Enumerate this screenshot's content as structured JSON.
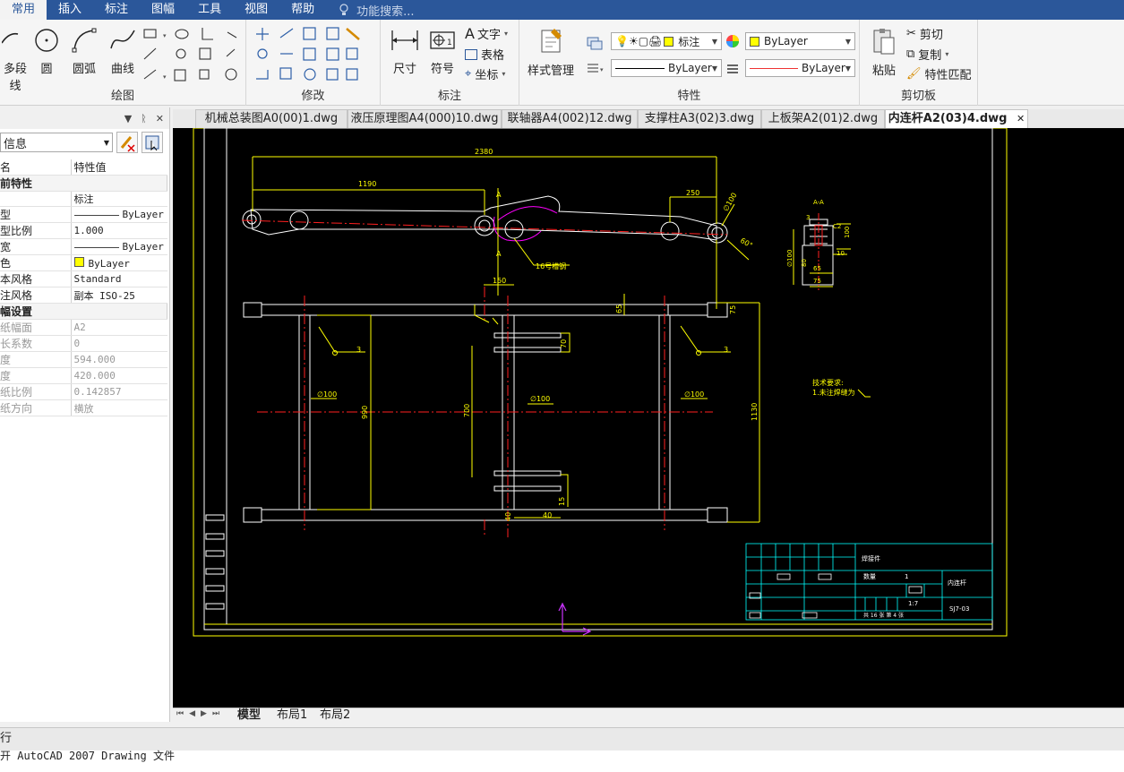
{
  "menu": {
    "items": [
      "常用",
      "插入",
      "标注",
      "图幅",
      "工具",
      "视图",
      "帮助"
    ],
    "search_placeholder": "功能搜索..."
  },
  "ribbon": {
    "draw": {
      "label": "绘图",
      "polyline": "多段线",
      "circle": "圆",
      "arc": "圆弧",
      "curve": "曲线"
    },
    "modify": {
      "label": "修改"
    },
    "dimension": {
      "label": "标注",
      "size": "尺寸",
      "symbol": "符号",
      "text": "文字",
      "table": "表格",
      "coord": "坐标"
    },
    "properties": {
      "label": "特性",
      "style_manager": "样式管理",
      "layer_name": "标注",
      "color_value": "ByLayer",
      "linetype_value": "ByLayer",
      "lineweight_value": "ByLayer"
    },
    "clipboard": {
      "label": "剪切板",
      "paste": "粘贴",
      "cut": "剪切",
      "copy": "复制",
      "match": "特性匹配"
    }
  },
  "props_panel": {
    "select_value": "信息",
    "rows": [
      {
        "k": "名",
        "v": "特性值",
        "kind": "header"
      },
      {
        "k": "前特性",
        "v": "",
        "kind": "sec"
      },
      {
        "k": "",
        "v": "标注",
        "kind": "row"
      },
      {
        "k": "型",
        "v": "ByLayer",
        "kind": "line"
      },
      {
        "k": "型比例",
        "v": "1.000",
        "kind": "row"
      },
      {
        "k": "宽",
        "v": "ByLayer",
        "kind": "line"
      },
      {
        "k": "色",
        "v": "ByLayer",
        "kind": "color"
      },
      {
        "k": "本风格",
        "v": "Standard",
        "kind": "row"
      },
      {
        "k": "注风格",
        "v": "副本 ISO-25",
        "kind": "row"
      },
      {
        "k": "幅设置",
        "v": "",
        "kind": "sec"
      },
      {
        "k": "纸幅面",
        "v": "A2",
        "kind": "dis"
      },
      {
        "k": "长系数",
        "v": "0",
        "kind": "dis"
      },
      {
        "k": "度",
        "v": "594.000",
        "kind": "dis"
      },
      {
        "k": "度",
        "v": "420.000",
        "kind": "dis"
      },
      {
        "k": "纸比例",
        "v": "0.142857",
        "kind": "dis"
      },
      {
        "k": "纸方向",
        "v": "横放",
        "kind": "dis"
      }
    ]
  },
  "doc_tabs": [
    "机械总装图A0(00)1.dwg",
    "液压原理图A4(000)10.dwg",
    "联轴器A4(002)12.dwg",
    "支撑柱A3(02)3.dwg",
    "上板架A2(01)2.dwg",
    "内连杆A2(03)4.dwg"
  ],
  "active_tab": "内连杆A2(03)4.dwg",
  "drawing": {
    "dims": {
      "d2380": "2380",
      "d1190": "1190",
      "d250": "250",
      "d150": "150",
      "d65": "65",
      "d75": "75",
      "d990": "990",
      "d700": "700",
      "d1130": "1130",
      "d70": "70",
      "d15": "15",
      "d40a": "40",
      "d40b": "40",
      "phi100a": "∅100",
      "phi100b": "∅100",
      "phi100c": "∅100",
      "phi100d": "∅100",
      "a": "A",
      "a2": "A",
      "deg": "60°",
      "steel": "16号槽钢",
      "three1": "3",
      "three2": "3"
    },
    "section": {
      "title": "A-A",
      "d100": "100",
      "d10": "10",
      "d65": "65",
      "d75": "75",
      "phi": "∅100",
      "d80": "80",
      "c2": "C2",
      "d3": "3"
    },
    "tech": {
      "title": "技术要求:",
      "line1": "1.未注焊缝为"
    },
    "title_block": {
      "name": "焊接件",
      "part": "内连杆",
      "qty_label": "数量",
      "qty": "1",
      "scale": "1:7",
      "code": "SJ7-03",
      "sheets": "共 16 张  第 4 张"
    }
  },
  "layout_tabs": [
    "模型",
    "布局1",
    "布局2"
  ],
  "command": {
    "label": "行"
  },
  "status_text": "开 AutoCAD 2007 Drawing 文件"
}
